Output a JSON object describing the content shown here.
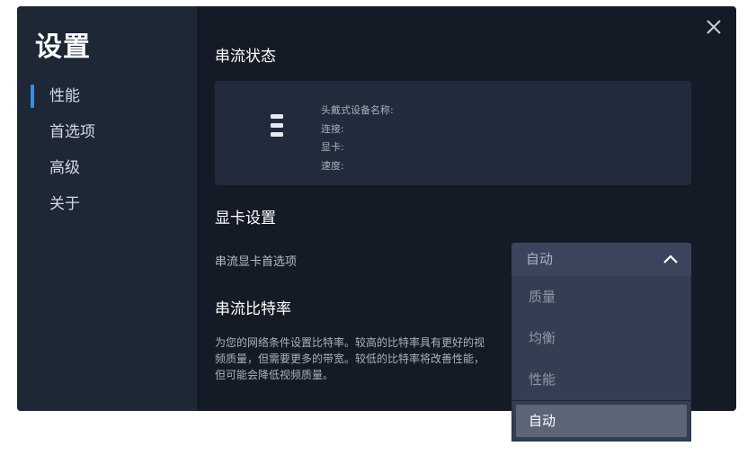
{
  "sidebar": {
    "title": "设置",
    "items": [
      {
        "label": "性能",
        "active": true
      },
      {
        "label": "首选项",
        "active": false
      },
      {
        "label": "高级",
        "active": false
      },
      {
        "label": "关于",
        "active": false
      }
    ]
  },
  "main": {
    "stream_status_heading": "串流状态",
    "status": {
      "headset_name_label": "头戴式设备名称:",
      "connection_label": "连接:",
      "gpu_label": "显卡:",
      "speed_label": "速度:"
    },
    "gpu_settings_heading": "显卡设置",
    "gpu_preference_label": "串流显卡首选项",
    "bitrate_heading": "串流比特率",
    "bitrate_description": "为您的网络条件设置比特率。较高的比特率具有更好的视频质量，但需要更多的带宽。较低的比特率将改善性能，但可能会降低视频质量。"
  },
  "dropdown": {
    "selected": "自动",
    "options": [
      "质量",
      "均衡",
      "性能",
      "自动"
    ]
  },
  "icons": {
    "close": "close-icon",
    "headset": "headset-icon",
    "chevron": "chevron-up-icon"
  },
  "colors": {
    "accent": "#3a8dde",
    "dialog_bg": "#151b26",
    "sidebar_bg": "#1e2736"
  }
}
